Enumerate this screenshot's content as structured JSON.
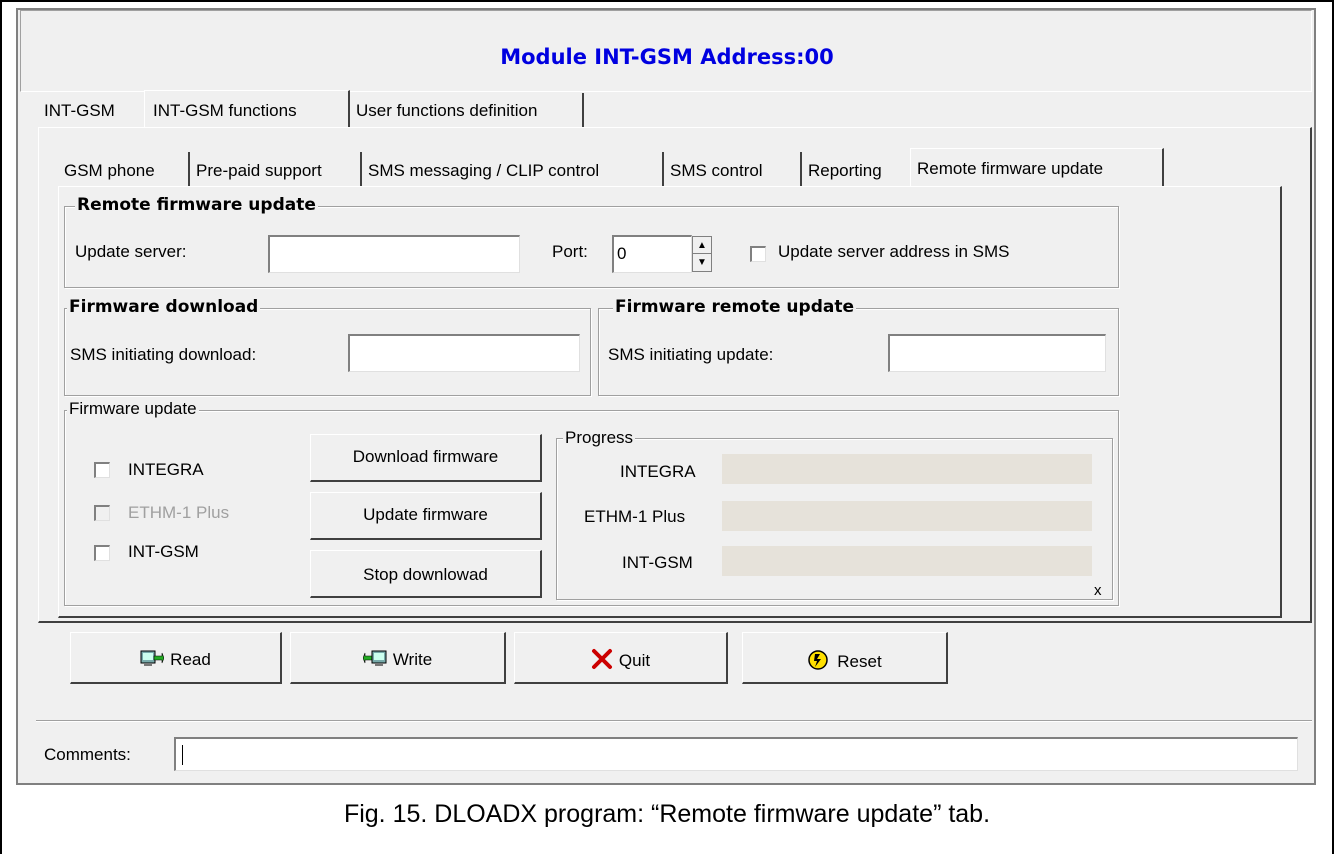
{
  "window": {
    "title": "Module INT-GSM Address:00"
  },
  "outer_tabs": [
    "INT-GSM",
    "INT-GSM functions",
    "User functions definition"
  ],
  "inner_tabs": [
    "GSM phone",
    "Pre-paid support",
    "SMS messaging / CLIP control",
    "SMS control",
    "Reporting",
    "Remote firmware update"
  ],
  "remote_update": {
    "title": "Remote firmware update",
    "server_label": "Update server:",
    "server_value": "",
    "port_label": "Port:",
    "port_value": "0",
    "sms_address_label": "Update server address in SMS"
  },
  "download": {
    "title": "Firmware download",
    "sms_label": "SMS initiating download:",
    "sms_value": ""
  },
  "remote": {
    "title": "Firmware remote update",
    "sms_label": "SMS initiating update:",
    "sms_value": ""
  },
  "firmware_update": {
    "title": "Firmware update",
    "checkboxes": [
      {
        "label": "INTEGRA",
        "enabled": true,
        "checked": false
      },
      {
        "label": "ETHM-1 Plus",
        "enabled": false,
        "checked": false
      },
      {
        "label": "INT-GSM",
        "enabled": true,
        "checked": false
      }
    ],
    "buttons": [
      "Download firmware",
      "Update firmware",
      "Stop downlowad"
    ],
    "progress": {
      "title": "Progress",
      "rows": [
        {
          "label": "INTEGRA",
          "value": 0
        },
        {
          "label": "ETHM-1 Plus",
          "value": 0
        },
        {
          "label": "INT-GSM",
          "value": 0
        }
      ],
      "mark": "x"
    }
  },
  "actions": [
    {
      "label": "Read",
      "icon": "read-icon"
    },
    {
      "label": "Write",
      "icon": "write-icon"
    },
    {
      "label": "Quit",
      "icon": "quit-icon",
      "color": "#cc0000"
    },
    {
      "label": "Reset",
      "icon": "reset-icon"
    }
  ],
  "comments": {
    "label": "Comments:",
    "value": ""
  },
  "caption": "Fig. 15. DLOADX program: “Remote firmware update” tab."
}
